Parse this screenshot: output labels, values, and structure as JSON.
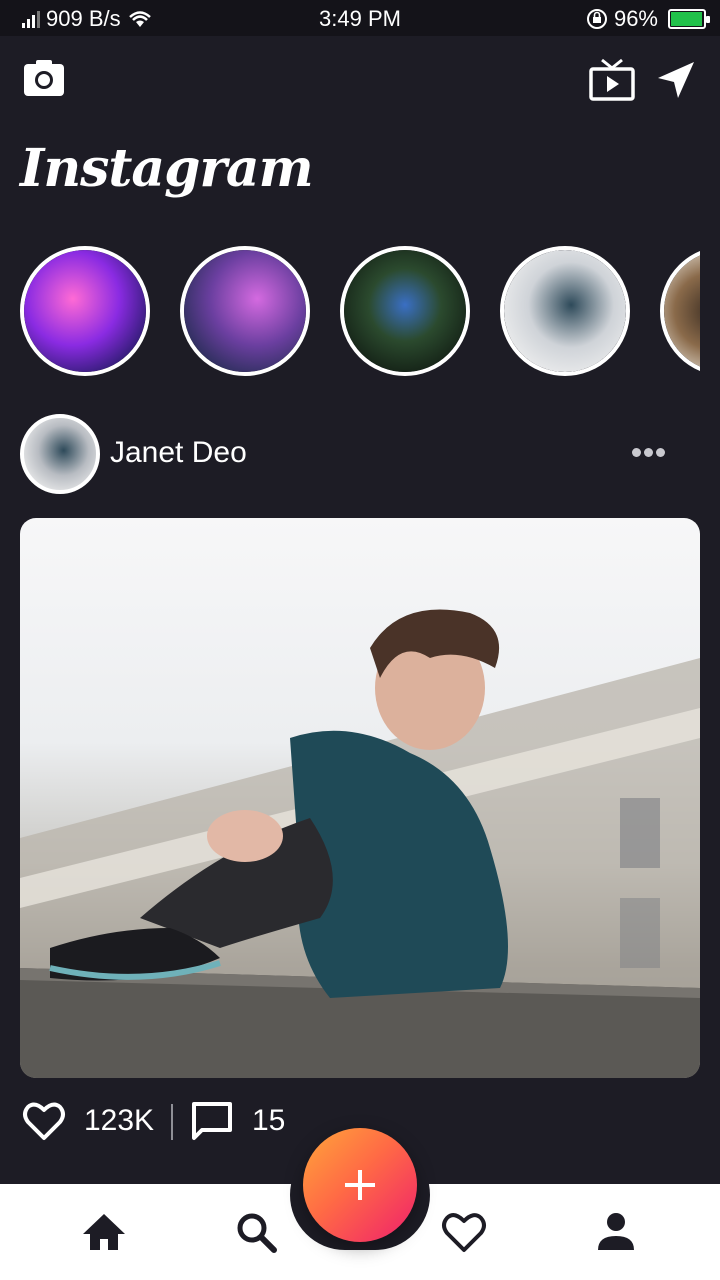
{
  "status_bar": {
    "network_speed": "909 B/s",
    "time": "3:49 PM",
    "battery_percent": "96%",
    "battery_level": 0.96,
    "battery_color": "#21c14a"
  },
  "header": {
    "logo": "Instagram",
    "icons": [
      "camera-icon",
      "tv-icon",
      "send-icon"
    ]
  },
  "stories": [
    {
      "icon": "story-avatar"
    },
    {
      "icon": "story-avatar"
    },
    {
      "icon": "story-avatar"
    },
    {
      "icon": "story-avatar"
    },
    {
      "icon": "story-avatar"
    }
  ],
  "post": {
    "username": "Janet Deo",
    "likes": "123K",
    "comments": "15"
  },
  "nav": {
    "items": [
      "home-icon",
      "search-icon",
      "add-icon",
      "heart-icon",
      "profile-icon"
    ],
    "fab_colors": [
      "#ffa63a",
      "#ef1f6c"
    ]
  }
}
